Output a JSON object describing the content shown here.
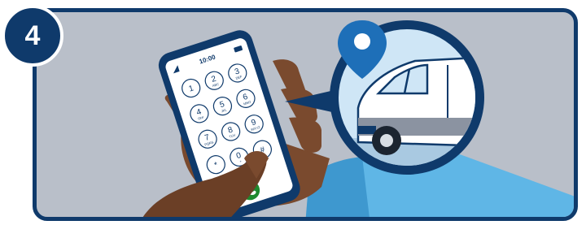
{
  "step": {
    "number": "4"
  },
  "phone": {
    "time": "10:00",
    "keypad": [
      {
        "digit": "1",
        "letters": ""
      },
      {
        "digit": "2",
        "letters": "ABC"
      },
      {
        "digit": "3",
        "letters": "DEF"
      },
      {
        "digit": "4",
        "letters": "GHI"
      },
      {
        "digit": "5",
        "letters": "JKL"
      },
      {
        "digit": "6",
        "letters": "MNO"
      },
      {
        "digit": "7",
        "letters": "PQRS"
      },
      {
        "digit": "8",
        "letters": "TUV"
      },
      {
        "digit": "9",
        "letters": "WXYZ"
      },
      {
        "digit": "*",
        "letters": ""
      },
      {
        "digit": "0",
        "letters": "+"
      },
      {
        "digit": "#",
        "letters": ""
      }
    ]
  },
  "icons": {
    "call": "phone-call-icon",
    "location": "location-pin-icon",
    "vehicle": "van-icon"
  },
  "colors": {
    "navy": "#0f3a6b",
    "pin_blue": "#1e6fb8",
    "sky": "#cfe6f6",
    "sleeve": "#5fb6e6",
    "skin": "#7a4a2e",
    "call_green": "#1f8a2e",
    "background": "#b9bfc9"
  }
}
